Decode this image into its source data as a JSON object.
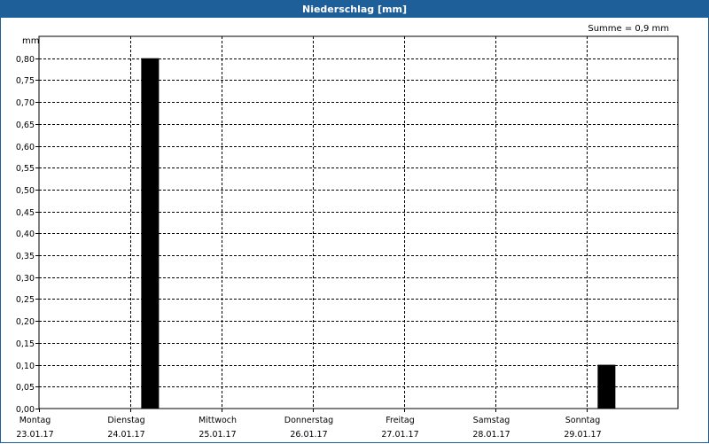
{
  "window": {
    "title": "Niederschlag [mm]"
  },
  "summary": "Summe = 0,9 mm",
  "colors": {
    "titlebar": "#1f5f99",
    "bar": "#000000",
    "grid": "#000000"
  },
  "chart_data": {
    "type": "bar",
    "title": "Niederschlag [mm]",
    "ylabel": "mm",
    "ylim": [
      0,
      0.85
    ],
    "yticks": [
      0,
      0.05,
      0.1,
      0.15,
      0.2,
      0.25,
      0.3,
      0.35,
      0.4,
      0.45,
      0.5,
      0.55,
      0.6,
      0.65,
      0.7,
      0.75,
      0.8
    ],
    "ytick_labels": [
      "0,00",
      "0,05",
      "0,10",
      "0,15",
      "0,20",
      "0,25",
      "0,30",
      "0,35",
      "0,40",
      "0,45",
      "0,50",
      "0,55",
      "0,60",
      "0,65",
      "0,70",
      "0,75",
      "0,80"
    ],
    "days": [
      {
        "day": "Montag",
        "date": "23.01.17"
      },
      {
        "day": "Dienstag",
        "date": "24.01.17"
      },
      {
        "day": "Mittwoch",
        "date": "25.01.17"
      },
      {
        "day": "Donnerstag",
        "date": "26.01.17"
      },
      {
        "day": "Freitag",
        "date": "27.01.17"
      },
      {
        "day": "Samstag",
        "date": "28.01.17"
      },
      {
        "day": "Sonntag",
        "date": "29.01.17"
      }
    ],
    "bars": [
      {
        "x": "24.01.17",
        "value": 0.8
      },
      {
        "x": "29.01.17",
        "value": 0.1
      }
    ],
    "grid": true
  }
}
